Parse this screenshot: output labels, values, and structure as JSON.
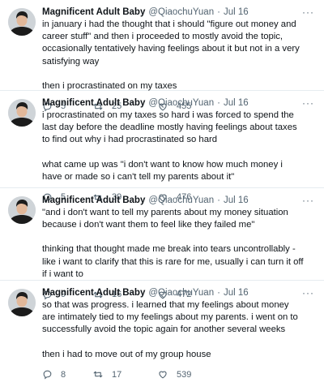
{
  "tweets": [
    {
      "name": "Magnificent Adult Baby",
      "handle": "@QiaochuYuan",
      "separator": "·",
      "date": "Jul 16",
      "paragraphs": [
        "in january i had the thought that i should \"figure out money and career stuff\" and then i proceeded to mostly avoid the topic, occasionally tentatively having feelings about it but not in a very satisfying way",
        "then i procrastinated on my taxes"
      ],
      "replies": "5",
      "retweets": "25",
      "likes": "455"
    },
    {
      "name": "Magnificent Adult Baby",
      "handle": "@QiaochuYuan",
      "separator": "·",
      "date": "Jul 16",
      "paragraphs": [
        "i procrastinated on my taxes so hard i was forced to spend the last day before the deadline mostly having feelings about taxes to find out why i had procrastinated so hard",
        "what came up was \"i don't want to know how much money i have or made so i can't tell my parents about it\""
      ],
      "replies": "5",
      "retweets": "39",
      "likes": "476"
    },
    {
      "name": "Magnificent Adult Baby",
      "handle": "@QiaochuYuan",
      "separator": "·",
      "date": "Jul 16",
      "paragraphs": [
        "\"and i don't want to tell my parents about my money situation because i don't want them to feel like they failed me\"",
        "thinking that thought made me break into tears uncontrollably - like i want to clarify that this is rare for me, usually i can turn it off if i want to"
      ],
      "replies": "9",
      "retweets": "16",
      "likes": "472"
    },
    {
      "name": "Magnificent Adult Baby",
      "handle": "@QiaochuYuan",
      "separator": "·",
      "date": "Jul 16",
      "paragraphs": [
        "so that was progress. i learned that my feelings about money are intimately tied to my feelings about my parents. i went on to successfully avoid the topic again for another several weeks",
        "then i had to move out of my group house"
      ],
      "replies": "8",
      "retweets": "17",
      "likes": "539"
    }
  ],
  "more_glyph": "···",
  "icons": {
    "reply": "reply-icon",
    "retweet": "retweet-icon",
    "like": "heart-icon",
    "more": "more-icon"
  },
  "colors": {
    "text": "#0f1419",
    "secondary": "#536471",
    "divider": "#e6ecf0"
  }
}
